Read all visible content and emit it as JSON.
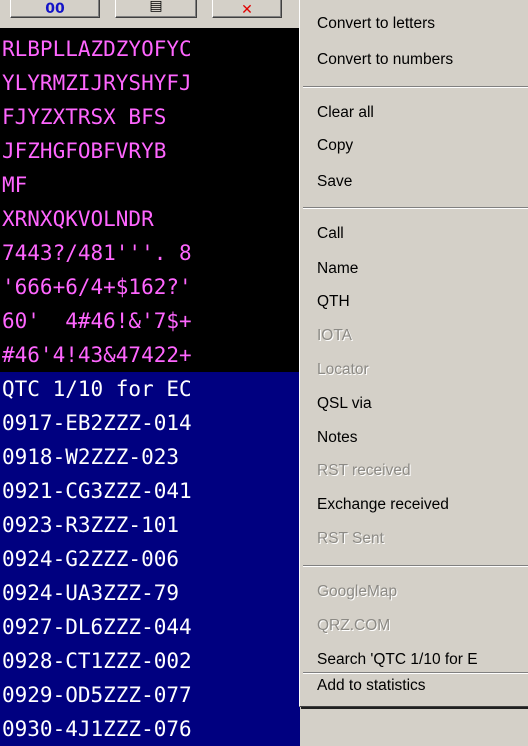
{
  "toolbar": {
    "buttons": [
      {
        "label": "00"
      },
      {
        "label": "▤"
      },
      {
        "label": "✕"
      }
    ]
  },
  "terminal": {
    "lines": [
      "RLBPLLAZDZYOFYC",
      "YLYRMZIJRYSHYFJ",
      "FJYZXTRSX BFS",
      "JFZHGFOBFVRYB",
      "MF",
      "XRNXQKVOLNDR",
      "7443?/481'''. 8",
      "'666+6/4+$162?'",
      "60'  4#46!&'7$+",
      "#46'4!43&47422+",
      "QTC 1/10 for EC",
      "0917-EB2ZZZ-014",
      "0918-W2ZZZ-023",
      "0921-CG3ZZZ-041",
      "0923-R3ZZZ-101",
      "0924-G2ZZZ-006",
      "0924-UA3ZZZ-79",
      "0927-DL6ZZZ-044",
      "0928-CT1ZZZ-002",
      "0929-OD5ZZZ-077",
      "0930-4J1ZZZ-076"
    ],
    "selected_from": 10
  },
  "menu": {
    "convert_letters": "Convert to letters",
    "convert_numbers": "Convert to numbers",
    "clear_all": "Clear all",
    "copy": "Copy",
    "save": "Save",
    "call": "Call",
    "name": "Name",
    "qth": "QTH",
    "iota": "IOTA",
    "locator": "Locator",
    "qsl_via": "QSL via",
    "notes": "Notes",
    "rst_received": "RST received",
    "exchange_received": "Exchange received",
    "rst_sent": "RST Sent",
    "googlemap": "GoogleMap",
    "qrz": "QRZ.COM",
    "search": "Search 'QTC 1/10 for E",
    "add_statistics": "Add to statistics"
  },
  "colors": {
    "menu_bg": "#d4d0c8",
    "terminal_bg": "#000000",
    "terminal_text": "#ff66ff",
    "selection_bg": "#000080",
    "selection_text": "#ffffff",
    "disabled_text": "#8c8a85"
  }
}
